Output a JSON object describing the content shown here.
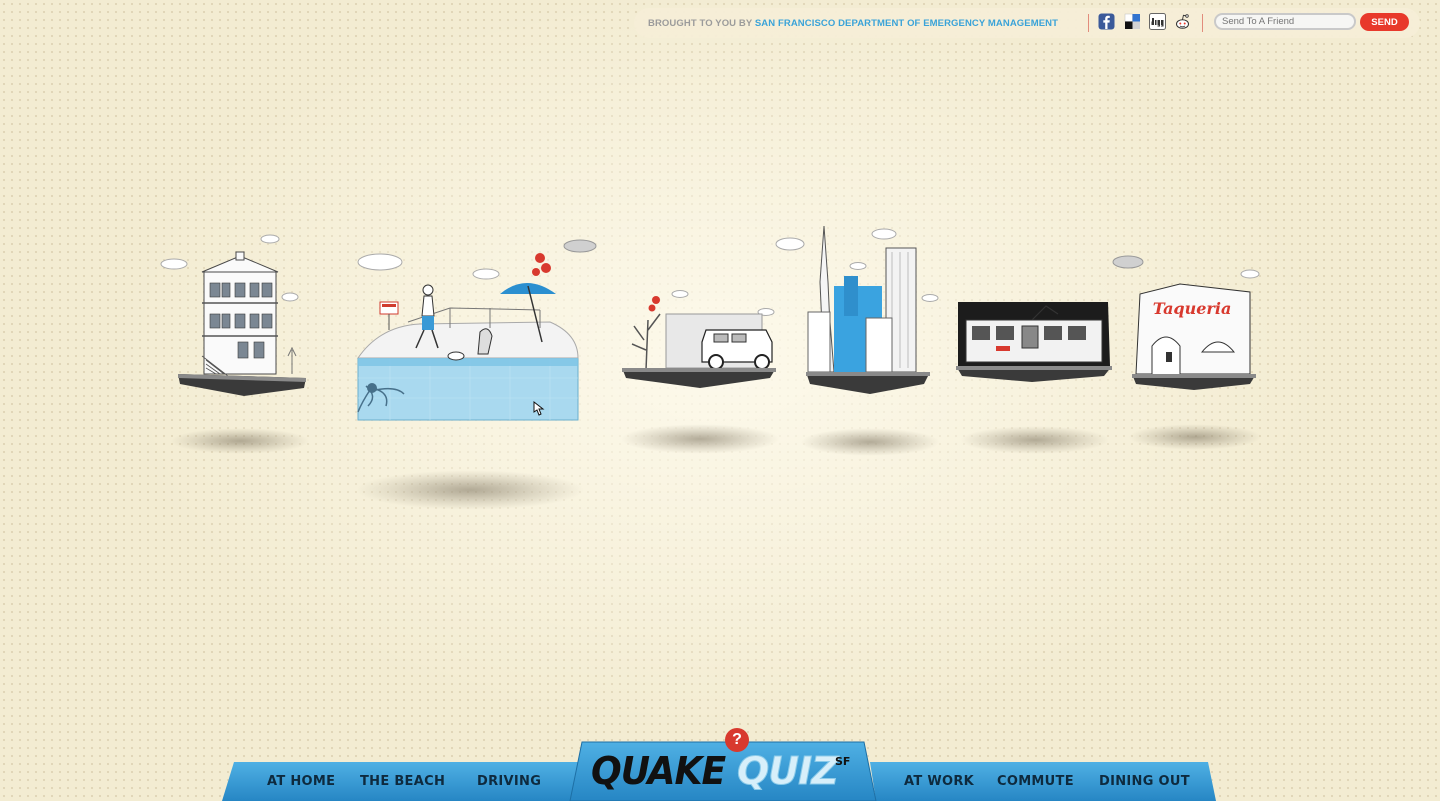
{
  "header": {
    "credit_prefix": "BROUGHT TO YOU BY",
    "credit_org": "SAN FRANCISCO DEPARTMENT OF EMERGENCY MANAGEMENT",
    "social_icons": [
      "facebook-icon",
      "delicious-icon",
      "digg-icon",
      "reddit-icon"
    ],
    "send_placeholder": "Send To A Friend",
    "send_label": "SEND"
  },
  "scenes": [
    {
      "id": "at-home",
      "label": "AT HOME"
    },
    {
      "id": "the-beach",
      "label": "THE BEACH"
    },
    {
      "id": "driving",
      "label": "DRIVING"
    },
    {
      "id": "at-work",
      "label": "AT WORK"
    },
    {
      "id": "commute",
      "label": "COMMUTE"
    },
    {
      "id": "dining-out",
      "label": "DINING OUT",
      "sign": "Taqueria"
    }
  ],
  "nav": {
    "left": [
      "AT HOME",
      "THE BEACH",
      "DRIVING"
    ],
    "right": [
      "AT WORK",
      "COMMUTE",
      "DINING OUT"
    ]
  },
  "logo": {
    "quake": "QUAKE",
    "quiz": "QUIZ",
    "sf": "SF",
    "badge": "?"
  },
  "colors": {
    "accent_blue": "#3aa3d8",
    "nav_blue": "#2e95d3",
    "send_red": "#e8392b",
    "badge_red": "#d8392e"
  }
}
